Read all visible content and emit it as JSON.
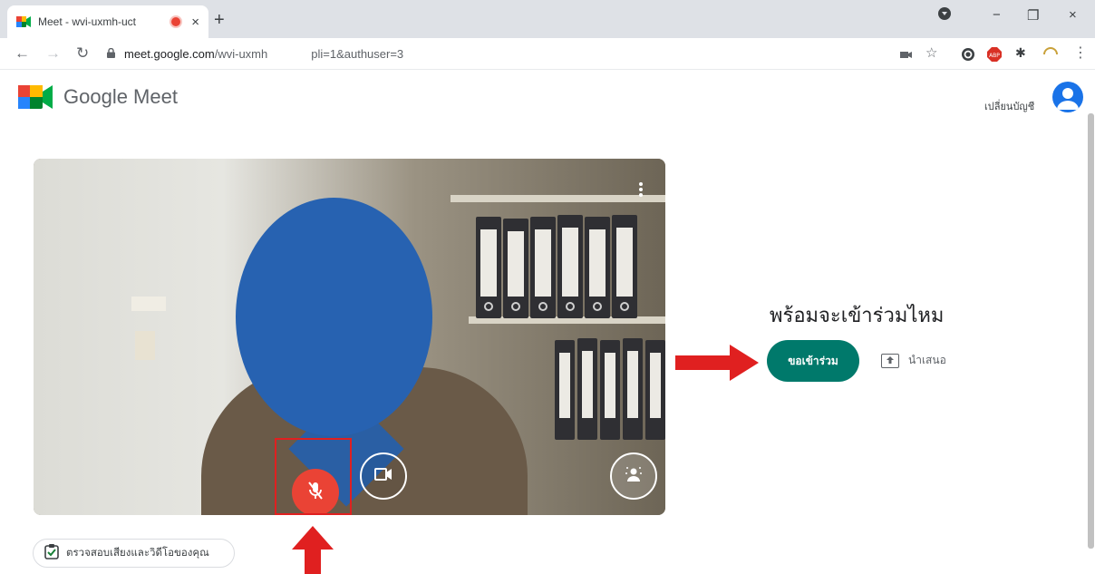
{
  "browser": {
    "tab_title": "Meet - wvi-uxmh-uct",
    "tab_close": "×",
    "new_tab": "+",
    "url_host": "meet.google.com",
    "url_path": "/wvi-uxmh",
    "url_query": "pli=1&authuser=3",
    "minimize": "−",
    "restore": "❐",
    "close": "×"
  },
  "meet": {
    "brand": "Google Meet",
    "account_label": "เปลี่ยนบัญชี",
    "ready_heading": "พร้อมจะเข้าร่วมไหม",
    "join_button": "ขอเข้าร่วม",
    "present_label": "นำเสนอ",
    "check_av": "ตรวจสอบเสียงและวิดีโอของคุณ"
  },
  "colors": {
    "join_bg": "#00796b",
    "mic_off": "#ea4335",
    "annotation_red": "#e02020",
    "face_mask": "#2762b1"
  },
  "icons": [
    "meet-favicon",
    "recording-icon",
    "back-icon",
    "forward-icon",
    "reload-icon",
    "lock-icon",
    "camera-icon",
    "star-icon",
    "extension-icon",
    "more-vert-icon",
    "mic-off-icon",
    "videocam-icon",
    "visual-effects-icon",
    "present-icon",
    "check-av-icon"
  ]
}
